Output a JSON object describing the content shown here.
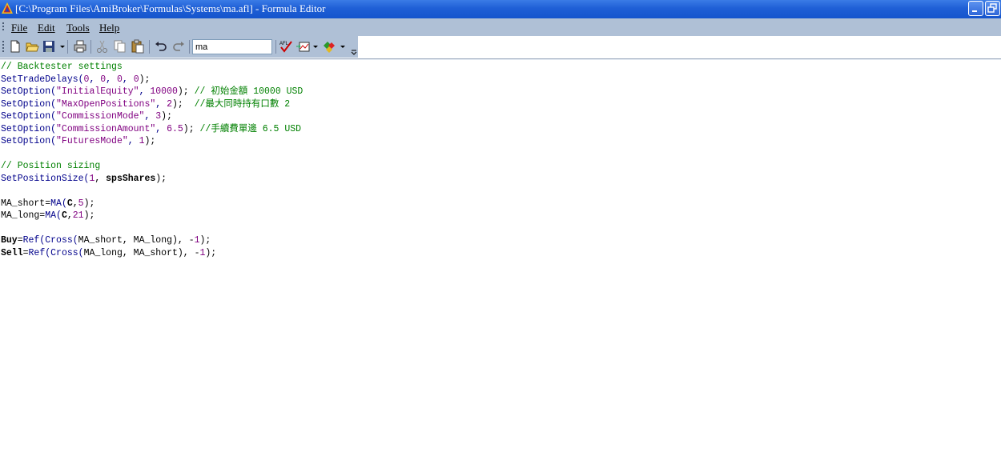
{
  "window": {
    "title": "[C:\\Program Files\\AmiBroker\\Formulas\\Systems\\ma.afl] - Formula Editor",
    "app_icon": "amibroker-logo-icon"
  },
  "menu": {
    "items": [
      "File",
      "Edit",
      "Tools",
      "Help"
    ]
  },
  "toolbar": {
    "buttons": [
      "new-file-icon",
      "open-folder-icon",
      "save-icon",
      "print-icon",
      "cut-icon",
      "copy-icon",
      "paste-icon",
      "undo-icon",
      "redo-icon",
      "afl-verify-icon",
      "send-to-analysis-icon",
      "apply-indicator-icon"
    ],
    "search_value": "ma"
  },
  "code": {
    "lines": [
      [
        {
          "t": "// Backtester settings",
          "c": "cm"
        }
      ],
      [
        {
          "t": "SetTradeDelays",
          "c": "fn"
        },
        {
          "t": "(",
          "c": "fn"
        },
        {
          "t": "0",
          "c": "num"
        },
        {
          "t": ", ",
          "c": "fn"
        },
        {
          "t": "0",
          "c": "num"
        },
        {
          "t": ", ",
          "c": "fn"
        },
        {
          "t": "0",
          "c": "num"
        },
        {
          "t": ", ",
          "c": "fn"
        },
        {
          "t": "0",
          "c": "num"
        },
        {
          "t": ");",
          "c": ""
        }
      ],
      [
        {
          "t": "SetOption",
          "c": "fn"
        },
        {
          "t": "(",
          "c": "fn"
        },
        {
          "t": "\"InitialEquity\"",
          "c": "str"
        },
        {
          "t": ", ",
          "c": "fn"
        },
        {
          "t": "10000",
          "c": "num"
        },
        {
          "t": "); ",
          "c": ""
        },
        {
          "t": "// 初始金額 10000 USD",
          "c": "cm"
        }
      ],
      [
        {
          "t": "SetOption",
          "c": "fn"
        },
        {
          "t": "(",
          "c": "fn"
        },
        {
          "t": "\"MaxOpenPositions\"",
          "c": "str"
        },
        {
          "t": ", ",
          "c": "fn"
        },
        {
          "t": "2",
          "c": "num"
        },
        {
          "t": ");  ",
          "c": ""
        },
        {
          "t": "//最大同時持有口數 2",
          "c": "cm"
        }
      ],
      [
        {
          "t": "SetOption",
          "c": "fn"
        },
        {
          "t": "(",
          "c": "fn"
        },
        {
          "t": "\"CommissionMode\"",
          "c": "str"
        },
        {
          "t": ", ",
          "c": "fn"
        },
        {
          "t": "3",
          "c": "num"
        },
        {
          "t": ");",
          "c": ""
        }
      ],
      [
        {
          "t": "SetOption",
          "c": "fn"
        },
        {
          "t": "(",
          "c": "fn"
        },
        {
          "t": "\"CommissionAmount\"",
          "c": "str"
        },
        {
          "t": ", ",
          "c": "fn"
        },
        {
          "t": "6.5",
          "c": "num"
        },
        {
          "t": "); ",
          "c": ""
        },
        {
          "t": "//手續費單邊 6.5 USD",
          "c": "cm"
        }
      ],
      [
        {
          "t": "SetOption",
          "c": "fn"
        },
        {
          "t": "(",
          "c": "fn"
        },
        {
          "t": "\"FuturesMode\"",
          "c": "str"
        },
        {
          "t": ", ",
          "c": "fn"
        },
        {
          "t": "1",
          "c": "num"
        },
        {
          "t": ");",
          "c": ""
        }
      ],
      [],
      [
        {
          "t": "// Position sizing",
          "c": "cm"
        }
      ],
      [
        {
          "t": "SetPositionSize",
          "c": "fn"
        },
        {
          "t": "(",
          "c": "fn"
        },
        {
          "t": "1",
          "c": "num"
        },
        {
          "t": ", ",
          "c": ""
        },
        {
          "t": "spsShares",
          "c": "kw"
        },
        {
          "t": ");",
          "c": ""
        }
      ],
      [],
      [
        {
          "t": "MA_short=",
          "c": ""
        },
        {
          "t": "MA",
          "c": "fn"
        },
        {
          "t": "(",
          "c": "fn"
        },
        {
          "t": "C",
          "c": "kw"
        },
        {
          "t": ",",
          "c": ""
        },
        {
          "t": "5",
          "c": "num"
        },
        {
          "t": ");",
          "c": ""
        }
      ],
      [
        {
          "t": "MA_long=",
          "c": ""
        },
        {
          "t": "MA",
          "c": "fn"
        },
        {
          "t": "(",
          "c": "fn"
        },
        {
          "t": "C",
          "c": "kw"
        },
        {
          "t": ",",
          "c": ""
        },
        {
          "t": "21",
          "c": "num"
        },
        {
          "t": ");",
          "c": ""
        }
      ],
      [],
      [
        {
          "t": "Buy",
          "c": "kw"
        },
        {
          "t": "=",
          "c": ""
        },
        {
          "t": "Ref",
          "c": "fn"
        },
        {
          "t": "(",
          "c": "fn"
        },
        {
          "t": "Cross",
          "c": "fn"
        },
        {
          "t": "(",
          "c": "fn"
        },
        {
          "t": "MA_short, MA_long), -",
          "c": ""
        },
        {
          "t": "1",
          "c": "num"
        },
        {
          "t": ");",
          "c": ""
        }
      ],
      [
        {
          "t": "Sell",
          "c": "kw"
        },
        {
          "t": "=",
          "c": ""
        },
        {
          "t": "Ref",
          "c": "fn"
        },
        {
          "t": "(",
          "c": "fn"
        },
        {
          "t": "Cross",
          "c": "fn"
        },
        {
          "t": "(",
          "c": "fn"
        },
        {
          "t": "MA_long, MA_short), -",
          "c": ""
        },
        {
          "t": "1",
          "c": "num"
        },
        {
          "t": ");",
          "c": ""
        }
      ]
    ]
  }
}
